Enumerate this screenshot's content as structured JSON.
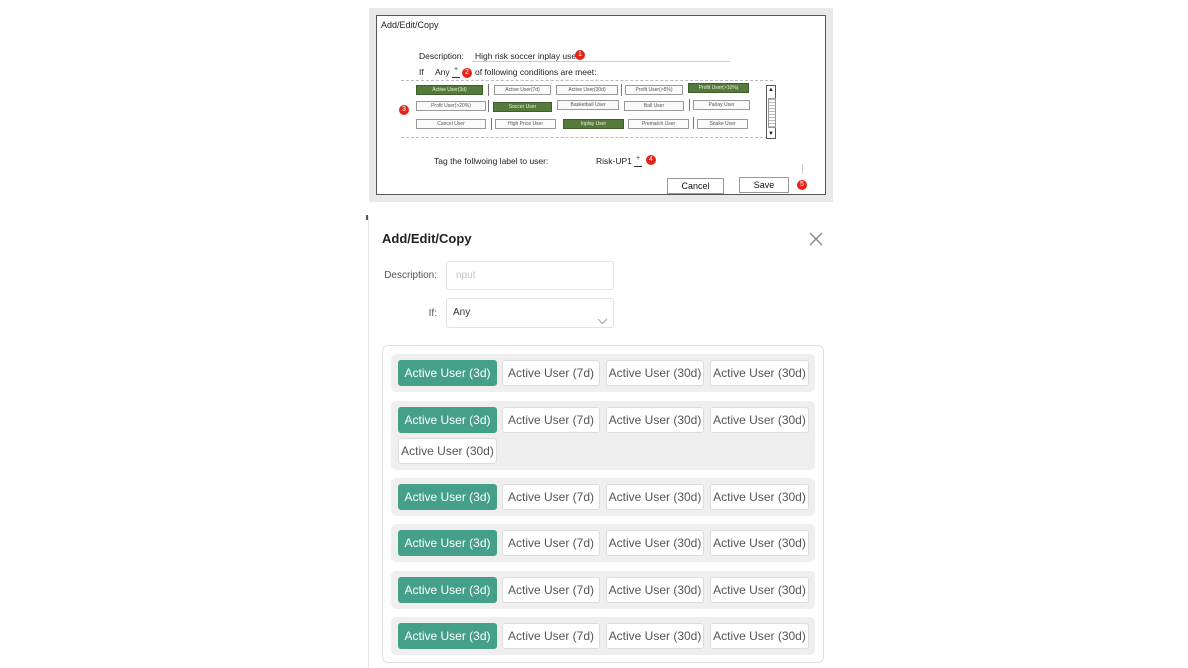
{
  "wireframe": {
    "title": "Add/Edit/Copy",
    "description_label": "Description:",
    "description_value": "High risk soccer inplay user",
    "if_label": "If",
    "if_value": "Any",
    "if_text": "of following conditions are meet:",
    "chips": [
      {
        "label": "Active User(3d)",
        "selected": true
      },
      {
        "label": "Active User(7d)",
        "selected": false
      },
      {
        "label": "Active User(30d)",
        "selected": false
      },
      {
        "label": "Profit User(>5%)",
        "selected": false
      },
      {
        "label": "Profit User(>10%)",
        "selected": true
      },
      {
        "label": "Profit User(>20%)",
        "selected": false
      },
      {
        "label": "Soccer User",
        "selected": true
      },
      {
        "label": "Basketball User",
        "selected": false
      },
      {
        "label": "Ball User",
        "selected": false
      },
      {
        "label": "Parlay User",
        "selected": false
      },
      {
        "label": "Cancel User",
        "selected": false
      },
      {
        "label": "High Price User",
        "selected": false
      },
      {
        "label": "Inplay User",
        "selected": true
      },
      {
        "label": "Prematch User",
        "selected": false
      },
      {
        "label": "Snake User",
        "selected": false
      }
    ],
    "tag_label": "Tag the follwoing label to user:",
    "tag_value": "Risk-UP1",
    "cancel_label": "Cancel",
    "save_label": "Save",
    "badges": [
      "1",
      "2",
      "3",
      "4",
      "5"
    ],
    "scroll_up": "▲",
    "scroll_down": "▼",
    "spin_glyph": "+"
  },
  "dialog": {
    "title": "Add/Edit/Copy",
    "description_label": "Description:",
    "description_placeholder": "nput",
    "if_label": "If:",
    "if_value": "Any",
    "groups": [
      {
        "chips": [
          {
            "label": "Active User (3d)",
            "selected": true
          },
          {
            "label": "Active User (7d)",
            "selected": false
          },
          {
            "label": "Active User (30d)",
            "selected": false
          },
          {
            "label": "Active User (30d)",
            "selected": false
          }
        ]
      },
      {
        "chips": [
          {
            "label": "Active User (3d)",
            "selected": true
          },
          {
            "label": "Active User (7d)",
            "selected": false
          },
          {
            "label": "Active User (30d)",
            "selected": false
          },
          {
            "label": "Active User (30d)",
            "selected": false
          },
          {
            "label": "Active User (30d)",
            "selected": false
          }
        ]
      },
      {
        "chips": [
          {
            "label": "Active User (3d)",
            "selected": true
          },
          {
            "label": "Active User (7d)",
            "selected": false
          },
          {
            "label": "Active User (30d)",
            "selected": false
          },
          {
            "label": "Active User (30d)",
            "selected": false
          }
        ]
      },
      {
        "chips": [
          {
            "label": "Active User (3d)",
            "selected": true
          },
          {
            "label": "Active User (7d)",
            "selected": false
          },
          {
            "label": "Active User (30d)",
            "selected": false
          },
          {
            "label": "Active User (30d)",
            "selected": false
          }
        ]
      },
      {
        "chips": [
          {
            "label": "Active User (3d)",
            "selected": true
          },
          {
            "label": "Active User (7d)",
            "selected": false
          },
          {
            "label": "Active User (30d)",
            "selected": false
          },
          {
            "label": "Active User (30d)",
            "selected": false
          }
        ]
      },
      {
        "chips": [
          {
            "label": "Active User (3d)",
            "selected": true
          },
          {
            "label": "Active User (7d)",
            "selected": false
          },
          {
            "label": "Active User (30d)",
            "selected": false
          },
          {
            "label": "Active User (30d)",
            "selected": false
          }
        ]
      }
    ],
    "colors": {
      "accent": "#45a089",
      "wire_selected": "#547a3c",
      "badge": "#e2241a"
    },
    "icons": {
      "close": "close-icon",
      "dropdown": "chevron-down-icon"
    }
  }
}
